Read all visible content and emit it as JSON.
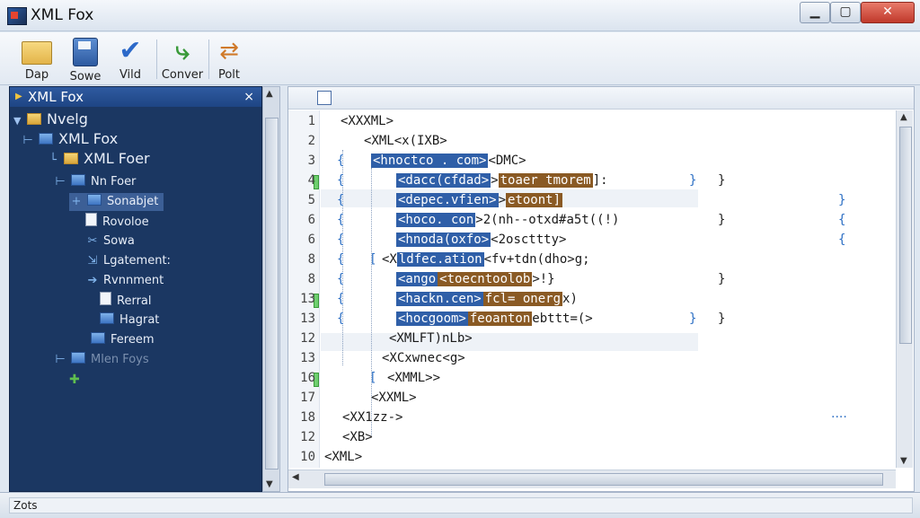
{
  "window": {
    "title": "XML Fox",
    "minimize": "▁",
    "maximize": "▢",
    "close": "✕"
  },
  "toolbar": {
    "buttons": [
      {
        "label": "Dap",
        "icon": "folder-open-icon"
      },
      {
        "label": "Sowe",
        "icon": "save-icon"
      },
      {
        "label": "Vild",
        "icon": "checkmark-icon"
      },
      {
        "label": "Conver",
        "icon": "convert-arrows-icon"
      },
      {
        "label": "Polt",
        "icon": "print-icon"
      }
    ]
  },
  "left_panel": {
    "title": "XML Fox",
    "close": "×",
    "tree": [
      {
        "label": "Nvelg"
      },
      {
        "label": "XML Fox"
      },
      {
        "label": "XML Foer"
      },
      {
        "label": "Nn Foer"
      },
      {
        "label": "Sonabjet"
      },
      {
        "label": "Rovoloe"
      },
      {
        "label": "Sowa"
      },
      {
        "label": "Lgatement:"
      },
      {
        "label": "Rvnnment"
      },
      {
        "label": "Rerral"
      },
      {
        "label": "Hagrat"
      },
      {
        "label": "Fereem"
      },
      {
        "label": "Mlen Foys"
      }
    ]
  },
  "editor": {
    "line_numbers": [
      "1",
      "2",
      "3",
      "4",
      "5",
      "6",
      "6",
      "8",
      "8",
      "13",
      "13",
      "12",
      "13",
      "16",
      "17",
      "18",
      "12",
      "10"
    ],
    "lines": [
      {
        "a": "<XXXML>"
      },
      {
        "a": "<XML<x(IXB>"
      },
      {
        "tag": "<hnoctco . com>",
        "rest": "<DMC>"
      },
      {
        "tag": "<dacc(cfdad>",
        "val": "toaer tmorem",
        "rest": "]:"
      },
      {
        "tag": "<depec.vfien>",
        "val": "etoont]",
        "rest": ""
      },
      {
        "tag": "<hoco. con",
        "rest": ">2(nh--otxd#a5t((!)"
      },
      {
        "tag": "<hnoda(oxfo>",
        "rest": "<2oscttty>"
      },
      {
        "pre": "<X",
        "tag": "ldfec.ation",
        "rest": "<fv+tdn(dho>g;"
      },
      {
        "tag": "<ango",
        "val": "<toecntoolob",
        "rest": ">!}"
      },
      {
        "tag": "<hackn.cen>",
        "val": "fcl= onerg",
        "rest": "x)"
      },
      {
        "tag": "<hocgoom>",
        "val": "feoanton",
        "rest": "ebttt=(>"
      },
      {
        "a": "<XMLFT)nLb>"
      },
      {
        "a": "<XCxwnec<g>"
      },
      {
        "a": "<XMML>>"
      },
      {
        "a": "<XXML>"
      },
      {
        "a": "<XX1zz->"
      },
      {
        "a": "<XB>"
      },
      {
        "a": "<XML>"
      }
    ],
    "ellipsis": "...."
  },
  "statusbar": {
    "text": "Zots"
  }
}
